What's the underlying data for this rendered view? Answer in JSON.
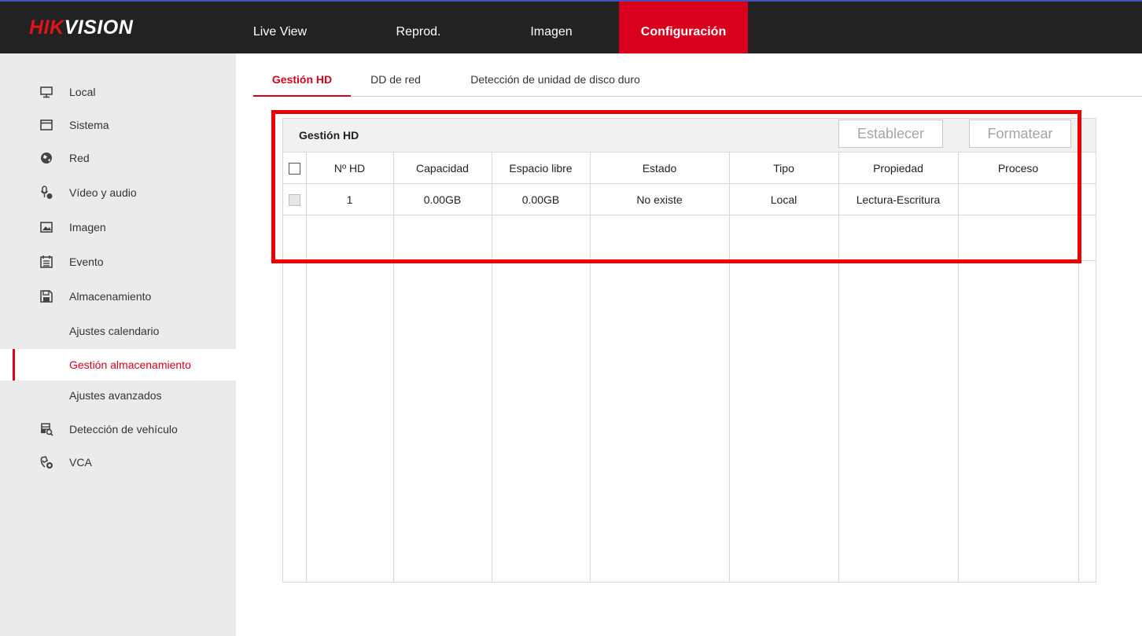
{
  "brand": {
    "logo_red": "HIK",
    "logo_white": "VISION"
  },
  "top_nav": {
    "live_view": "Live View",
    "playback": "Reprod.",
    "image": "Imagen",
    "config": "Configuración",
    "active": "Configuración"
  },
  "sidebar": {
    "local": "Local",
    "system": "Sistema",
    "network": "Red",
    "video_audio": "Vídeo y audio",
    "image": "Imagen",
    "event": "Evento",
    "storage": "Almacenamiento",
    "schedule": "Ajustes calendario",
    "storage_mgmt": "Gestión almacenamiento",
    "advanced": "Ajustes avanzados",
    "vehicle": "Detección de vehículo",
    "vca": "VCA"
  },
  "sub_tabs": {
    "hd_mgmt": "Gestión HD",
    "net_hd": "DD de red",
    "hd_detect": "Detección de unidad de disco duro"
  },
  "panel": {
    "title": "Gestión HD",
    "set_button": "Establecer",
    "format_button": "Formatear"
  },
  "table": {
    "headers": {
      "hd_no": "Nº HD",
      "capacity": "Capacidad",
      "free_space": "Espacio libre",
      "status": "Estado",
      "type": "Tipo",
      "property": "Propiedad",
      "progress": "Proceso"
    },
    "rows": [
      {
        "hd_no": "1",
        "capacity": "0.00GB",
        "free_space": "0.00GB",
        "status": "No existe",
        "type": "Local",
        "property": "Lectura-Escritura",
        "progress": ""
      }
    ]
  },
  "colors": {
    "accent": "#d9001b",
    "topbar": "#222222",
    "sidebar": "#ebebeb",
    "highlight": "#ee0000"
  }
}
